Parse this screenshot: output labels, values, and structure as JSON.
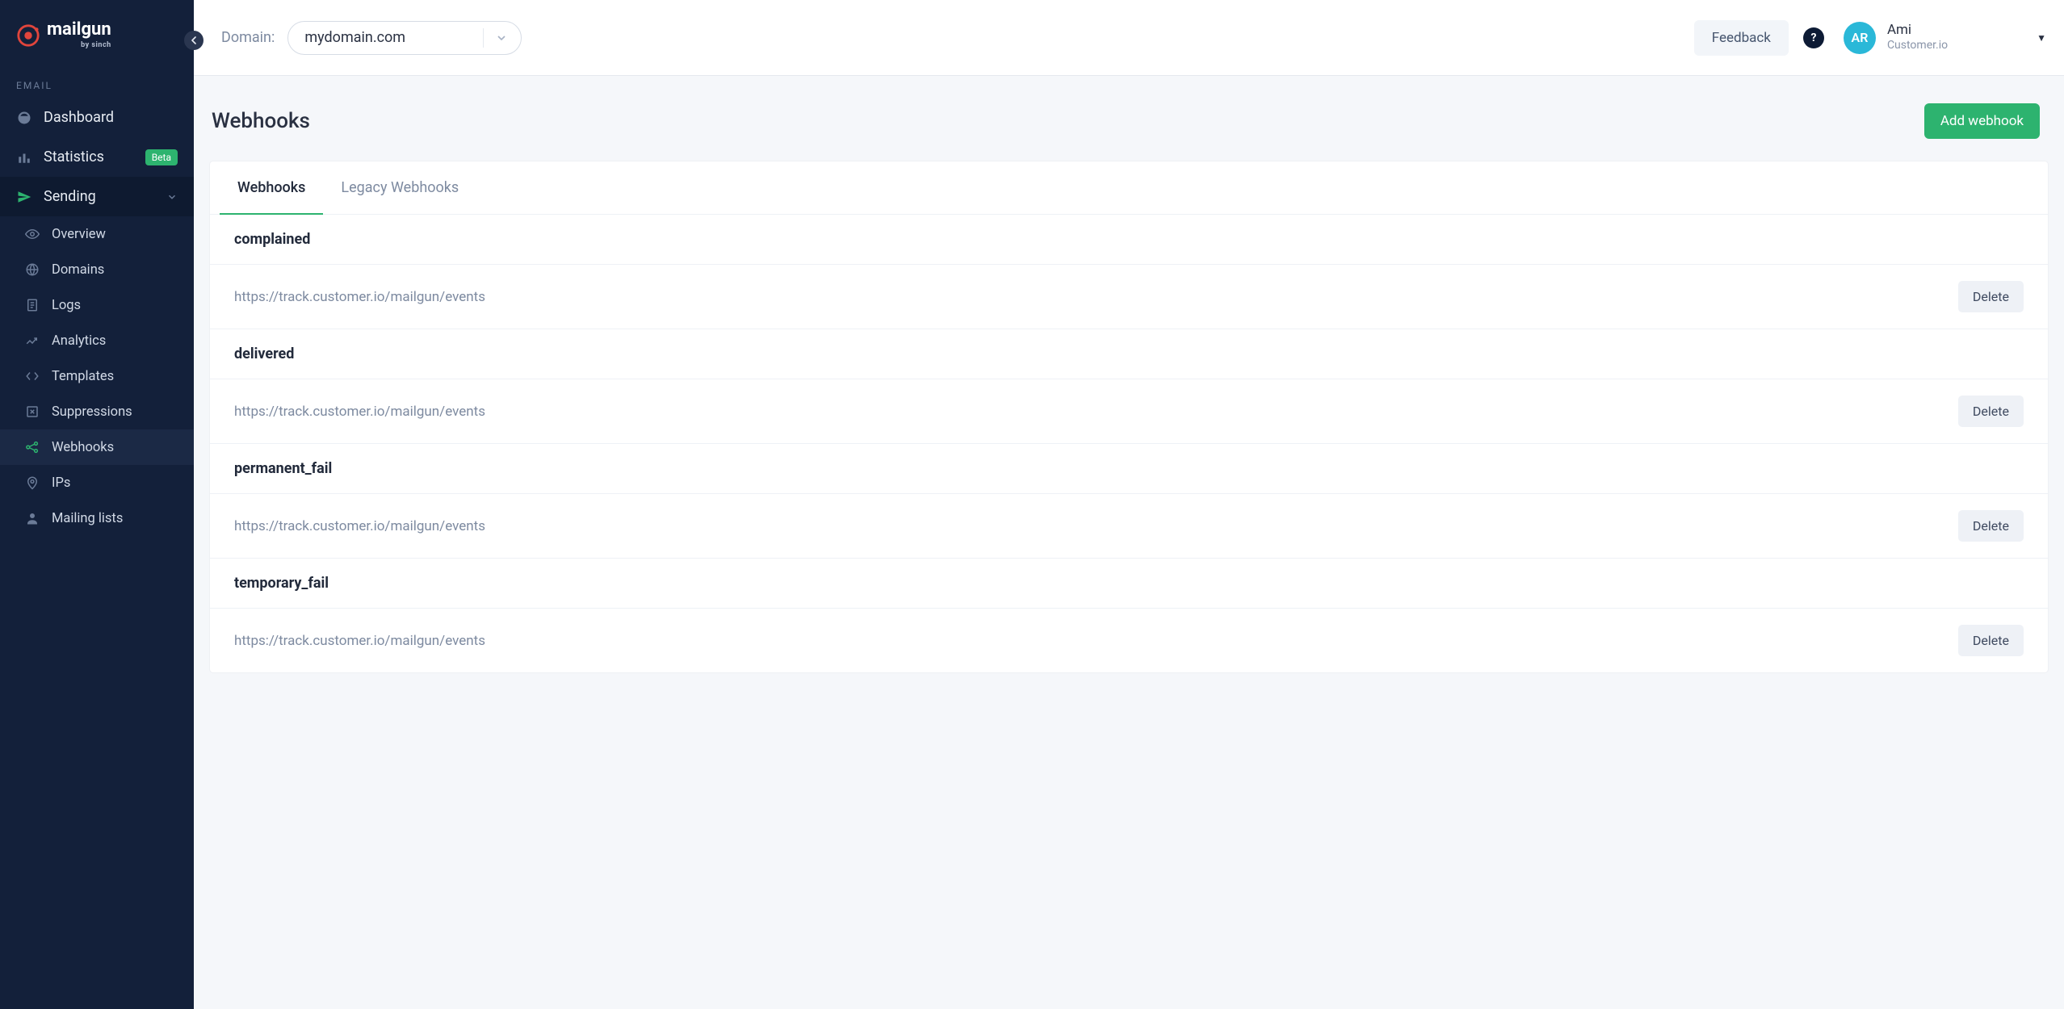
{
  "brand": {
    "name": "mailgun",
    "byline": "by sinch"
  },
  "sidebar": {
    "sectionLabel": "EMAIL",
    "items": [
      {
        "label": "Dashboard",
        "key": "dashboard"
      },
      {
        "label": "Statistics",
        "key": "statistics",
        "badge": "Beta"
      },
      {
        "label": "Sending",
        "key": "sending",
        "expandable": true
      }
    ],
    "sending": [
      {
        "label": "Overview",
        "key": "overview"
      },
      {
        "label": "Domains",
        "key": "domains"
      },
      {
        "label": "Logs",
        "key": "logs"
      },
      {
        "label": "Analytics",
        "key": "analytics"
      },
      {
        "label": "Templates",
        "key": "templates"
      },
      {
        "label": "Suppressions",
        "key": "suppressions"
      },
      {
        "label": "Webhooks",
        "key": "webhooks"
      },
      {
        "label": "IPs",
        "key": "ips"
      },
      {
        "label": "Mailing lists",
        "key": "mailing-lists"
      }
    ]
  },
  "topbar": {
    "domainLabel": "Domain:",
    "domainValue": "mydomain.com",
    "feedback": "Feedback",
    "user": {
      "initials": "AR",
      "name": "Ami",
      "org": "Customer.io"
    }
  },
  "page": {
    "title": "Webhooks",
    "addBtn": "Add webhook",
    "tabs": [
      {
        "label": "Webhooks",
        "active": true
      },
      {
        "label": "Legacy Webhooks",
        "active": false
      }
    ],
    "deleteLabel": "Delete",
    "sections": [
      {
        "name": "complained",
        "urls": [
          "https://track.customer.io/mailgun/events"
        ]
      },
      {
        "name": "delivered",
        "urls": [
          "https://track.customer.io/mailgun/events"
        ]
      },
      {
        "name": "permanent_fail",
        "urls": [
          "https://track.customer.io/mailgun/events"
        ]
      },
      {
        "name": "temporary_fail",
        "urls": [
          "https://track.customer.io/mailgun/events"
        ]
      }
    ]
  }
}
